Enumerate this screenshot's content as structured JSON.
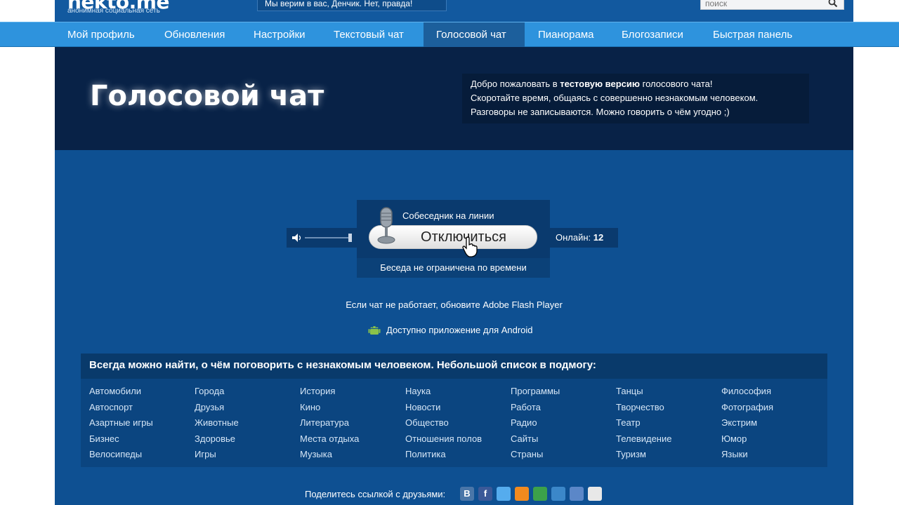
{
  "header": {
    "logo": "nekto.me",
    "tagline": "анонимная социальная сеть",
    "slogan": "Мы верим в вас, Денчик. Нет, правда!",
    "search_placeholder": "поиск"
  },
  "nav": {
    "items": [
      {
        "label": "Мой профиль"
      },
      {
        "label": "Обновления"
      },
      {
        "label": "Настройки"
      },
      {
        "label": "Текстовый чат"
      },
      {
        "label": "Голосовой чат",
        "active": true
      },
      {
        "label": "Пианорама"
      },
      {
        "label": "Блогозаписи"
      },
      {
        "label": "Быстрая панель"
      }
    ]
  },
  "hero": {
    "title": "Голосовой чат",
    "welcome_pre": "Добро пожаловать в ",
    "welcome_bold": "тестовую версию",
    "welcome_post": " голосового чата!",
    "welcome_line2": "Скоротайте время, общаясь с совершенно незнакомым человеком.",
    "welcome_line3": "Разговоры не записываются. Можно говорить о чём угодно ;)"
  },
  "chat": {
    "status": "Собеседник на линии",
    "disconnect_label": "Отключиться",
    "footer": "Беседа не ограничена по времени",
    "online_label": "Онлайн:",
    "online_count": "12",
    "volume_level": 1.0
  },
  "notes": {
    "flash": "Если чат не работает, обновите Adobe Flash Player",
    "android": "Доступно приложение для Android"
  },
  "topics": {
    "heading": "Всегда можно найти, о чём поговорить с незнакомым человеком. Небольшой список в подмогу:",
    "columns": [
      [
        "Автомобили",
        "Автоспорт",
        "Азартные игры",
        "Бизнес",
        "Велосипеды"
      ],
      [
        "Города",
        "Друзья",
        "Животные",
        "Здоровье",
        "Игры"
      ],
      [
        "История",
        "Кино",
        "Литература",
        "Места отдыха",
        "Музыка"
      ],
      [
        "Наука",
        "Новости",
        "Общество",
        "Отношения полов",
        "Политика"
      ],
      [
        "Программы",
        "Работа",
        "Радио",
        "Сайты",
        "Страны"
      ],
      [
        "Танцы",
        "Творчество",
        "Театр",
        "Телевидение",
        "Туризм"
      ],
      [
        "Философия",
        "Фотография",
        "Экстрим",
        "Юмор",
        "Языки"
      ]
    ]
  },
  "share": {
    "label": "Поделитесь ссылкой с друзьями:",
    "icons": [
      "vkontakte-icon",
      "facebook-icon",
      "twitter-icon",
      "odnoklassniki-icon",
      "mail-agent-icon",
      "livejournal-icon",
      "friendfeed-icon",
      "memori-icon"
    ],
    "colors": [
      "#4a76a8",
      "#3b5998",
      "#55acee",
      "#f28a1e",
      "#3ca14a",
      "#3b87c9",
      "#5b87c8",
      "#e8e8e8"
    ]
  }
}
